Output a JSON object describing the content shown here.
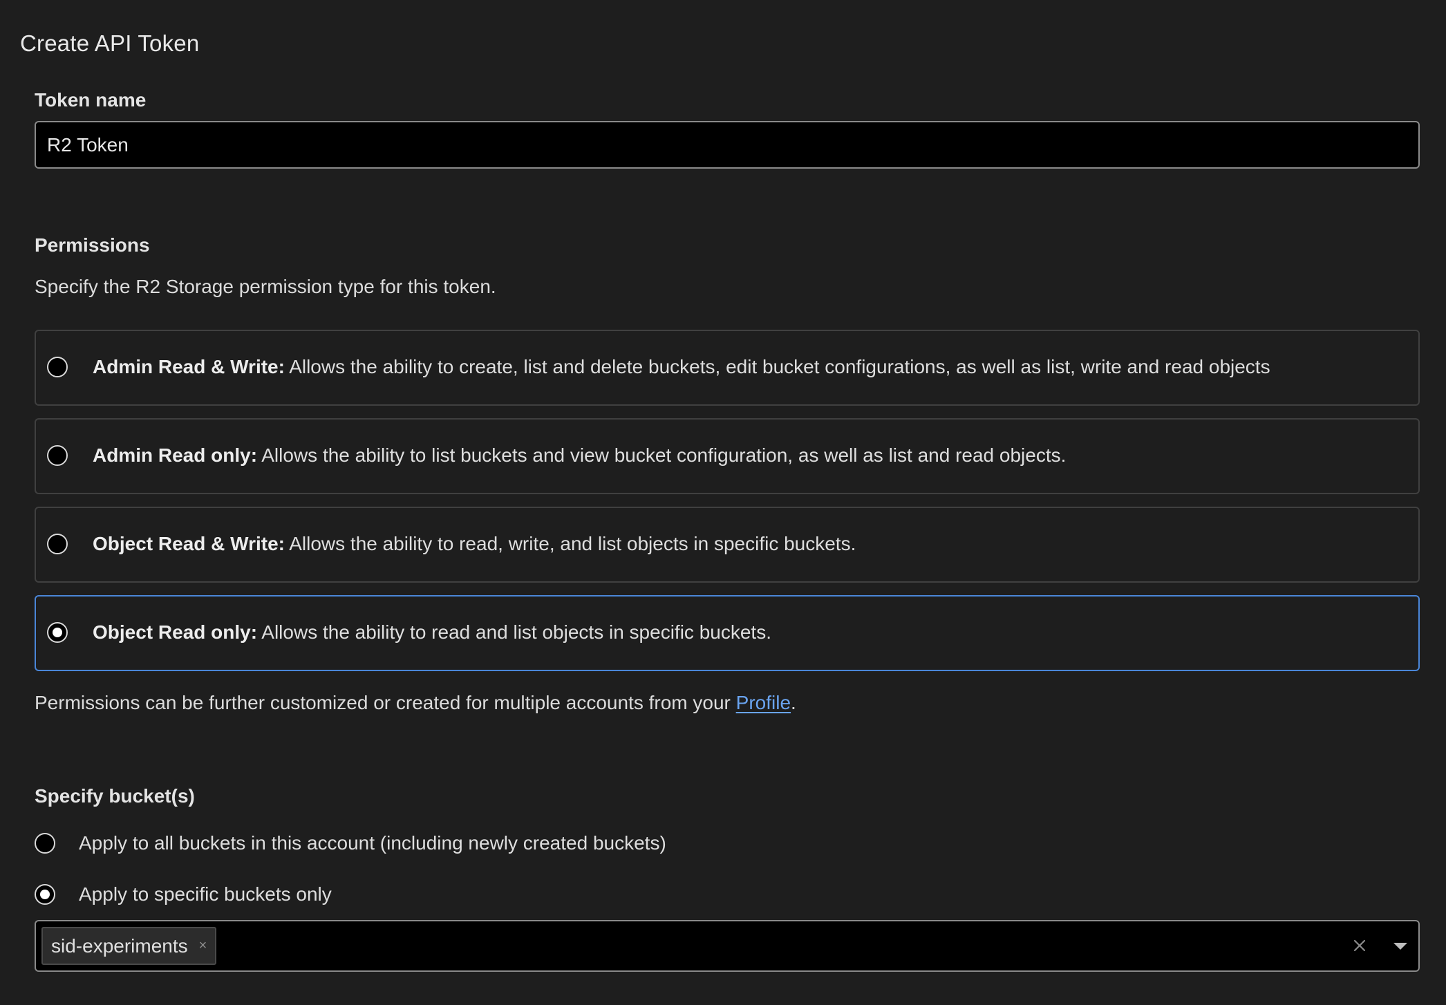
{
  "page": {
    "title": "Create API Token"
  },
  "token_name": {
    "label": "Token name",
    "value": "R2 Token"
  },
  "permissions": {
    "heading": "Permissions",
    "description": "Specify the R2 Storage permission type for this token.",
    "options": [
      {
        "title": "Admin Read & Write:",
        "description": " Allows the ability to create, list and delete buckets, edit bucket configurations, as well as list, write and read objects",
        "selected": false
      },
      {
        "title": "Admin Read only:",
        "description": " Allows the ability to list buckets and view bucket configuration, as well as list and read objects.",
        "selected": false
      },
      {
        "title": "Object Read & Write:",
        "description": " Allows the ability to read, write, and list objects in specific buckets.",
        "selected": false
      },
      {
        "title": "Object Read only:",
        "description": " Allows the ability to read and list objects in specific buckets.",
        "selected": true
      }
    ],
    "footnote_prefix": "Permissions can be further customized or created for multiple accounts from your ",
    "footnote_link": "Profile",
    "footnote_suffix": "."
  },
  "buckets": {
    "heading": "Specify bucket(s)",
    "options": [
      {
        "label": "Apply to all buckets in this account (including newly created buckets)",
        "selected": false
      },
      {
        "label": "Apply to specific buckets only",
        "selected": true
      }
    ],
    "selected_tags": [
      "sid-experiments"
    ],
    "tag_remove_glyph": "×"
  },
  "colors": {
    "background": "#1e1e1e",
    "input_background": "#000000",
    "selected_border": "#4a86d8",
    "link": "#6aa4f0"
  }
}
